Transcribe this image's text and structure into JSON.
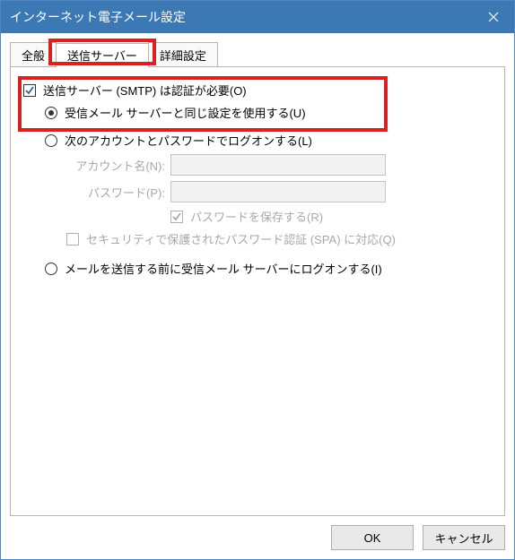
{
  "window": {
    "title": "インターネット電子メール設定"
  },
  "tabs": {
    "general": "全般",
    "outgoing": "送信サーバー",
    "advanced": "詳細設定"
  },
  "panel": {
    "auth_required": "送信サーバー (SMTP) は認証が必要(O)",
    "same_as_incoming": "受信メール サーバーと同じ設定を使用する(U)",
    "logon_with": "次のアカウントとパスワードでログオンする(L)",
    "account_label": "アカウント名(N):",
    "password_label": "パスワード(P):",
    "remember_password": "パスワードを保存する(R)",
    "spa": "セキュリティで保護されたパスワード認証 (SPA) に対応(Q)",
    "logon_before_send": "メールを送信する前に受信メール サーバーにログオンする(I)"
  },
  "buttons": {
    "ok": "OK",
    "cancel": "キャンセル"
  }
}
